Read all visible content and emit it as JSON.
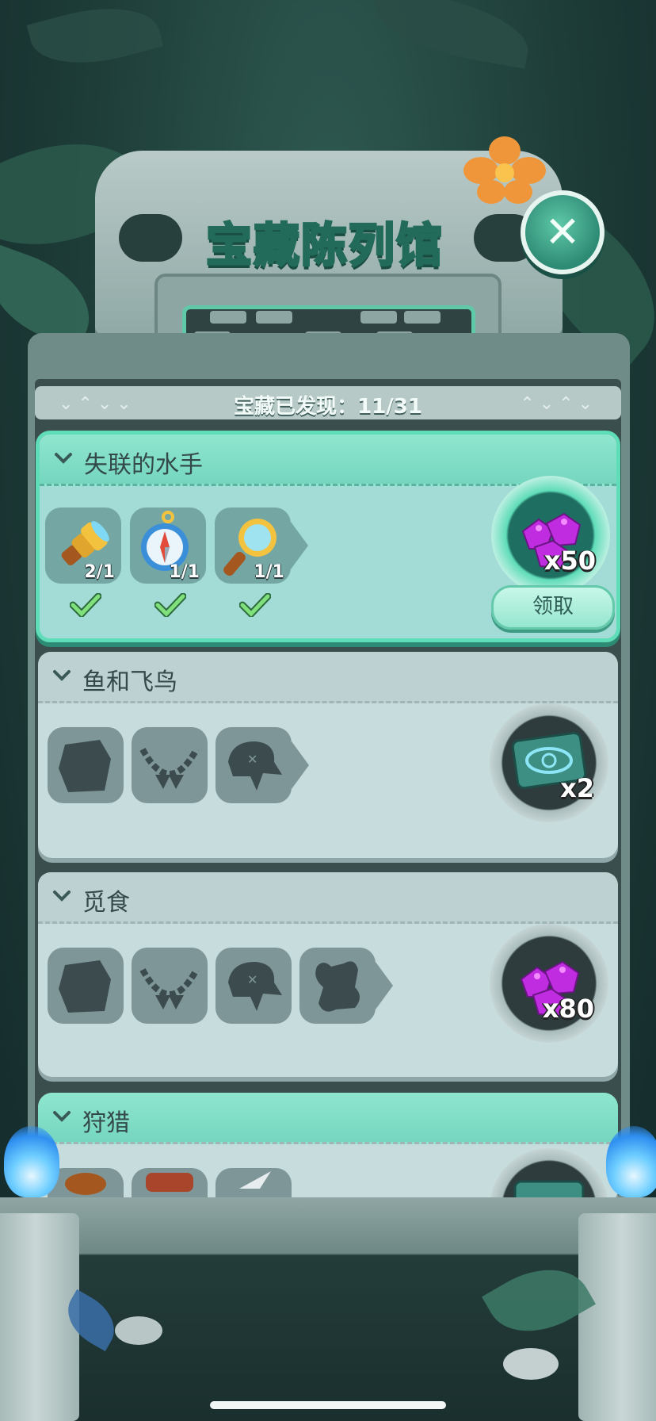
{
  "header": {
    "title": "宝藏陈列馆",
    "discovered_label": "宝藏已发现：11/31"
  },
  "collections": [
    {
      "title": "失联的水手",
      "state": "completed",
      "items": [
        {
          "icon": "spyglass-icon",
          "count": "2/1",
          "collected": true
        },
        {
          "icon": "compass-icon",
          "count": "1/1",
          "collected": true
        },
        {
          "icon": "magnifying-glass-icon",
          "count": "1/1",
          "collected": true
        }
      ],
      "reward": {
        "icon": "purple-gems-icon",
        "qty": "x50"
      },
      "claim_label": "领取"
    },
    {
      "title": "鱼和飞鸟",
      "state": "locked",
      "items": [
        {
          "icon": "stone-slab-silhouette-icon"
        },
        {
          "icon": "bone-necklace-silhouette-icon"
        },
        {
          "icon": "bird-skull-silhouette-icon"
        }
      ],
      "reward": {
        "icon": "eye-ticket-icon",
        "qty": "x2"
      }
    },
    {
      "title": "觅食",
      "state": "locked",
      "items": [
        {
          "icon": "stone-slab-silhouette-icon"
        },
        {
          "icon": "bone-necklace-silhouette-icon"
        },
        {
          "icon": "bird-skull-silhouette-icon"
        },
        {
          "icon": "bone-cluster-silhouette-icon"
        }
      ],
      "reward": {
        "icon": "purple-gems-icon",
        "qty": "x80"
      }
    },
    {
      "title": "狩猎",
      "state": "partial",
      "items": [
        {
          "icon": "pouch-icon"
        },
        {
          "icon": "leather-bag-icon"
        },
        {
          "icon": "arrowhead-icon"
        }
      ],
      "reward": {
        "icon": "eye-ticket-icon"
      }
    }
  ],
  "colors": {
    "accent": "#5fdcb8",
    "card_bg": "#c7dcdd",
    "active_card_bg": "#a3dcd6",
    "silhouette": "#3c4c4e",
    "gem": "#c02de0"
  }
}
